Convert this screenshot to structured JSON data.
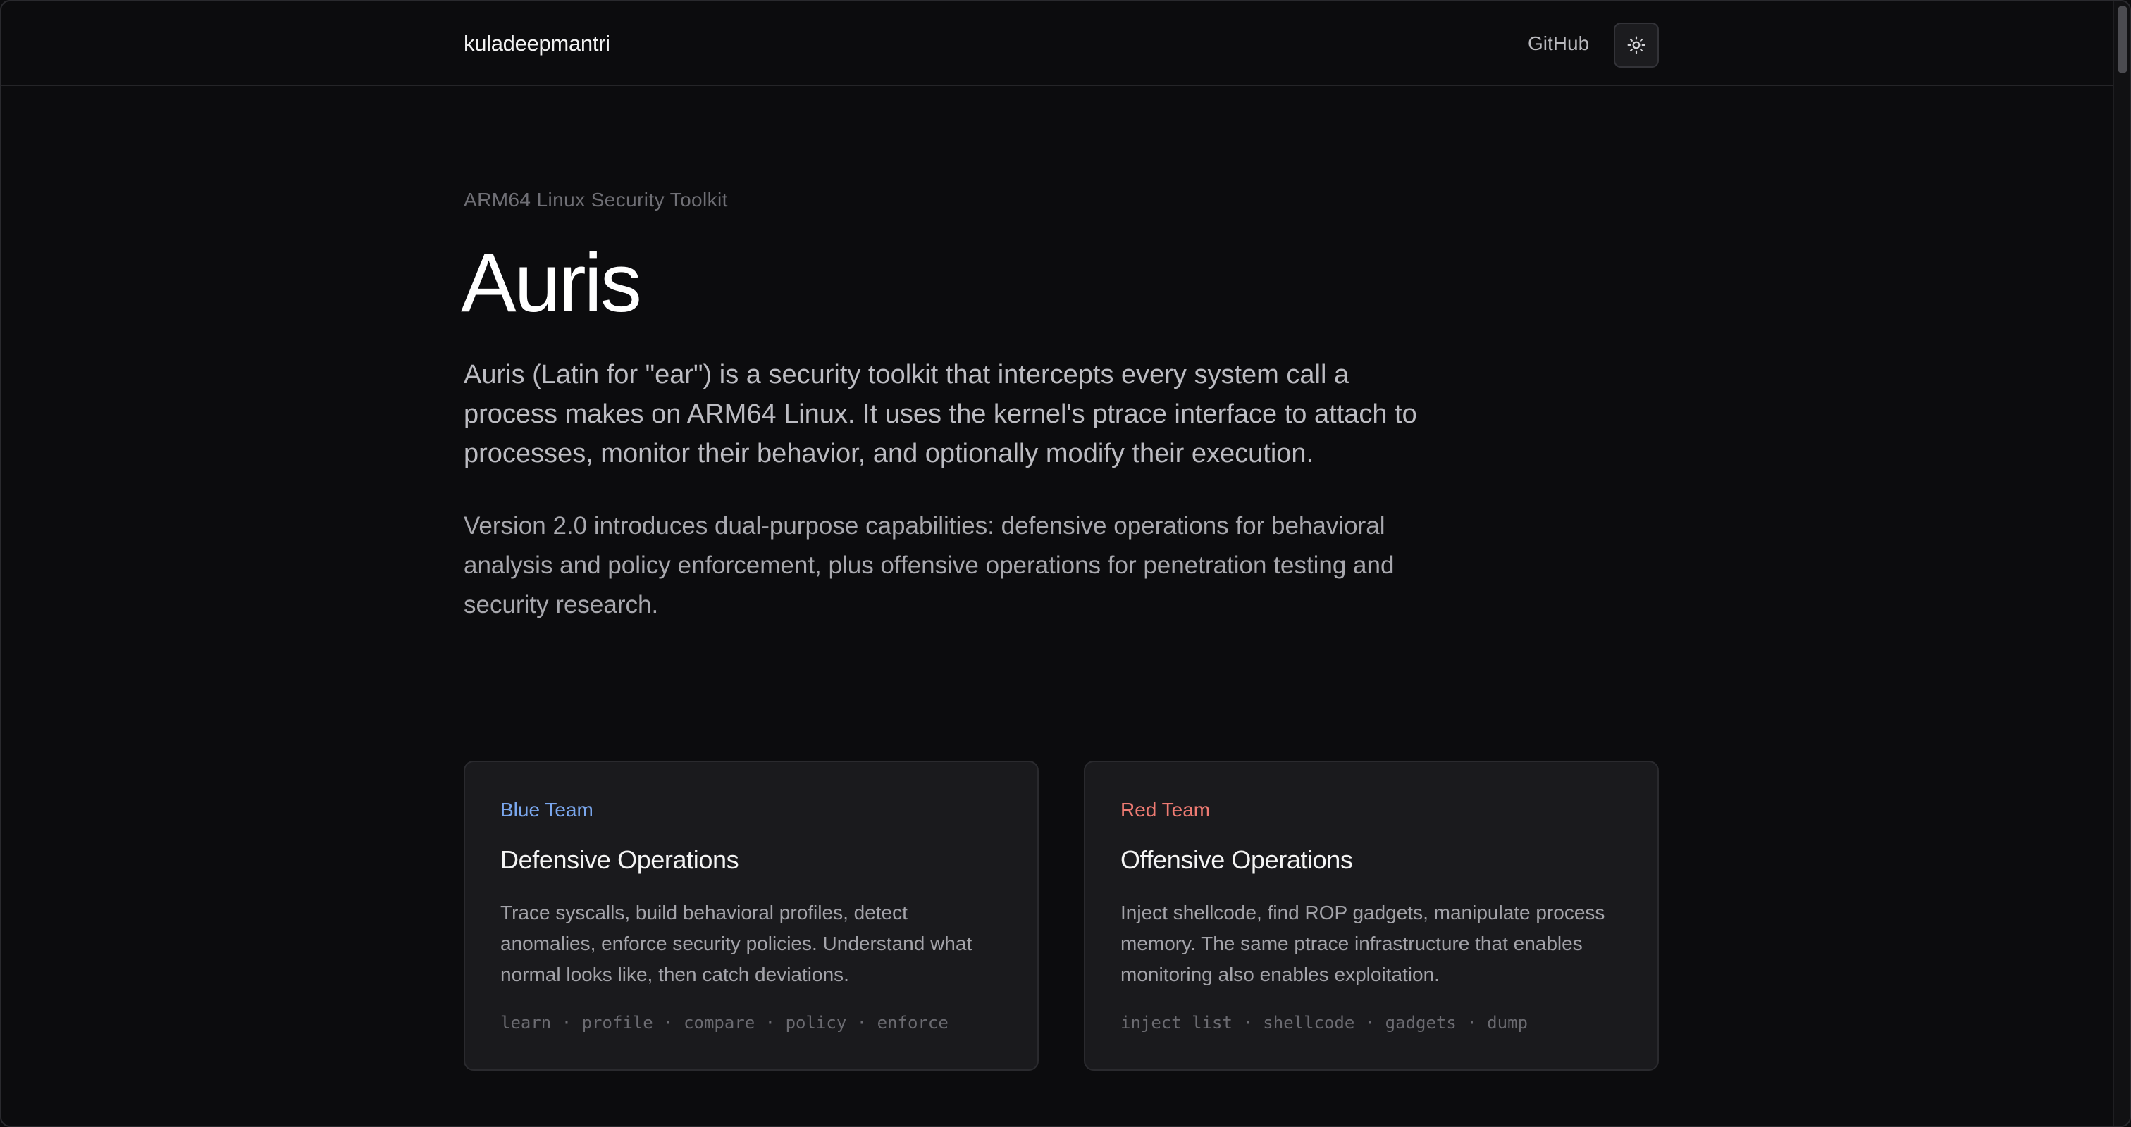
{
  "header": {
    "brand": "kuladeepmantri",
    "github_label": "GitHub",
    "theme_toggle_icon": "sun-icon"
  },
  "hero": {
    "eyebrow": "ARM64 Linux Security Toolkit",
    "title": "Auris",
    "lead": "Auris (Latin for \"ear\") is a security toolkit that intercepts every system call a process makes on ARM64 Linux. It uses the kernel's ptrace interface to attach to processes, monitor their behavior, and optionally modify their execution.",
    "lead2": "Version 2.0 introduces dual-purpose capabilities: defensive operations for behavioral analysis and policy enforcement, plus offensive operations for penetration testing and security research."
  },
  "cards": [
    {
      "tag": "Blue Team",
      "title": "Defensive Operations",
      "description": "Trace syscalls, build behavioral profiles, detect anomalies, enforce security policies. Understand what normal looks like, then catch deviations.",
      "commands": "learn · profile · compare · policy · enforce"
    },
    {
      "tag": "Red Team",
      "title": "Offensive Operations",
      "description": "Inject shellcode, find ROP gadgets, manipulate process memory. The same ptrace infrastructure that enables monitoring also enables exploitation.",
      "commands": "inject list · shellcode · gadgets · dump"
    }
  ],
  "colors": {
    "background": "#0c0c0e",
    "card_background": "#1a1a1d",
    "blue_accent": "#7aa7ee",
    "red_accent": "#ef7b73"
  }
}
